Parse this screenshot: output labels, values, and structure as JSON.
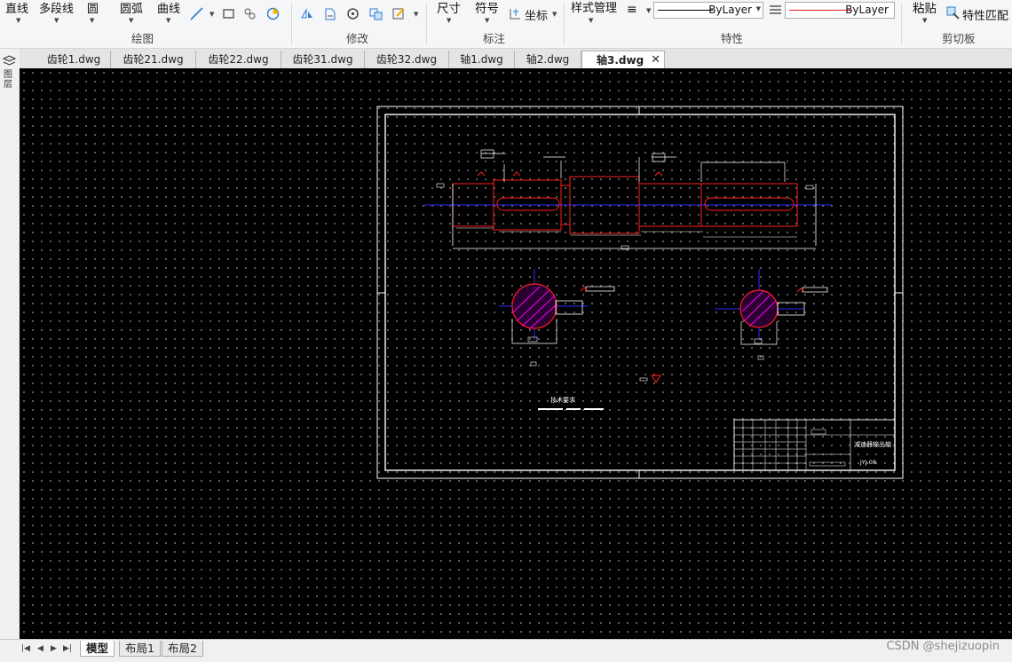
{
  "ribbon": {
    "draw": {
      "line": "直线",
      "polyline": "多段线",
      "circle": "圆",
      "arc": "圆弧",
      "curve": "曲线",
      "group": "绘图"
    },
    "modify": {
      "group": "修改"
    },
    "annotate": {
      "dimension": "尺寸",
      "symbol": "符号",
      "coordinate": "坐标",
      "group": "标注"
    },
    "properties": {
      "style_manager": "样式管理",
      "linetype_value": "ByLayer",
      "lineweight_value": "ByLayer",
      "group": "特性"
    },
    "clipboard": {
      "paste": "粘贴",
      "match_properties": "特性匹配",
      "group": "剪切板"
    }
  },
  "left_strip": {
    "label": "图层"
  },
  "doc_tabs": [
    "齿轮1.dwg",
    "齿轮21.dwg",
    "齿轮22.dwg",
    "齿轮31.dwg",
    "齿轮32.dwg",
    "轴1.dwg",
    "轴2.dwg",
    "轴3.dwg"
  ],
  "active_tab": "轴3.dwg",
  "layout_tabs": {
    "model": "模型",
    "layout1": "布局1",
    "layout2": "布局2"
  },
  "watermark": "CSDN @shejizuopin",
  "drawing": {
    "tech_req": "技术要求",
    "title": "减速器输出轴",
    "code": "JYJ-08"
  },
  "colors": {
    "canvas": "#000000",
    "frame": "#ffffff",
    "outline": "#ff0000",
    "centerline": "#3030ff",
    "hatch": "#ff00ff"
  }
}
